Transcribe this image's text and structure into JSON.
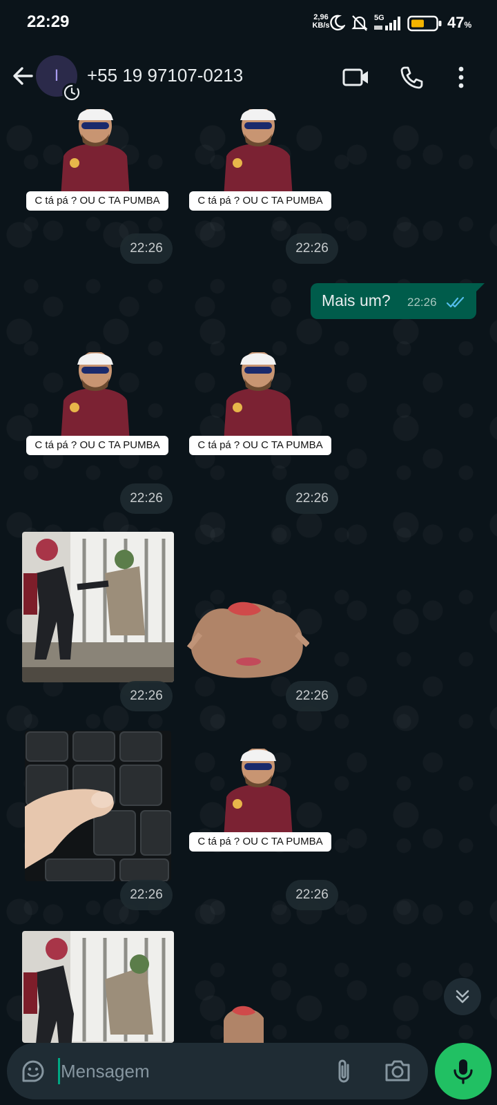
{
  "status_bar": {
    "time": "22:29",
    "net_speed_value": "2,96",
    "net_speed_unit": "KB/s",
    "network": "5G",
    "battery_percent": "47",
    "battery_percent_sign": "%"
  },
  "header": {
    "avatar_initial": "I",
    "contact": "+55 19 97107-0213"
  },
  "messages": {
    "sticker_caption": "C tá pá ? OU C TA PUMBA",
    "time": "22:26",
    "outgoing_text": "Mais um?"
  },
  "composer": {
    "placeholder": "Mensagem"
  },
  "colors": {
    "background": "#0b141a",
    "outgoing_bubble": "#005c4b",
    "accent_green": "#21c063",
    "read_ticks": "#53bdeb"
  },
  "icons": {
    "back": "arrow-left-icon",
    "video": "video-call-icon",
    "call": "phone-icon",
    "menu": "more-vertical-icon",
    "emoji": "sticker-icon",
    "attach": "paperclip-icon",
    "camera": "camera-icon",
    "mic": "microphone-icon",
    "scroll": "double-chevron-down-icon"
  }
}
